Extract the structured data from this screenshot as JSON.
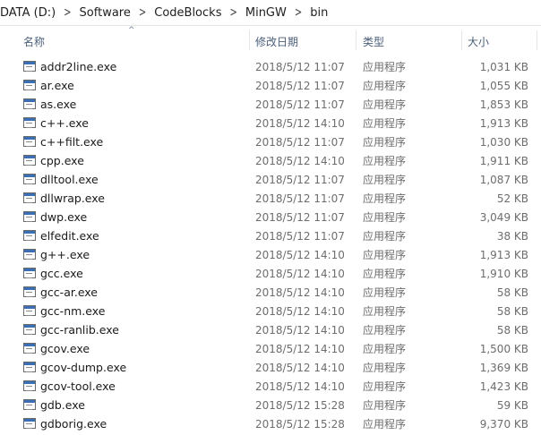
{
  "breadcrumb": [
    "DATA (D:)",
    "Software",
    "CodeBlocks",
    "MinGW",
    "bin"
  ],
  "columns": {
    "name": "名称",
    "date": "修改日期",
    "type": "类型",
    "size": "大小"
  },
  "files": [
    {
      "name": "addr2line.exe",
      "date": "2018/5/12 11:07",
      "type": "应用程序",
      "size": "1,031 KB"
    },
    {
      "name": "ar.exe",
      "date": "2018/5/12 11:07",
      "type": "应用程序",
      "size": "1,055 KB"
    },
    {
      "name": "as.exe",
      "date": "2018/5/12 11:07",
      "type": "应用程序",
      "size": "1,853 KB"
    },
    {
      "name": "c++.exe",
      "date": "2018/5/12 14:10",
      "type": "应用程序",
      "size": "1,913 KB"
    },
    {
      "name": "c++filt.exe",
      "date": "2018/5/12 11:07",
      "type": "应用程序",
      "size": "1,030 KB"
    },
    {
      "name": "cpp.exe",
      "date": "2018/5/12 14:10",
      "type": "应用程序",
      "size": "1,911 KB"
    },
    {
      "name": "dlltool.exe",
      "date": "2018/5/12 11:07",
      "type": "应用程序",
      "size": "1,087 KB"
    },
    {
      "name": "dllwrap.exe",
      "date": "2018/5/12 11:07",
      "type": "应用程序",
      "size": "52 KB"
    },
    {
      "name": "dwp.exe",
      "date": "2018/5/12 11:07",
      "type": "应用程序",
      "size": "3,049 KB"
    },
    {
      "name": "elfedit.exe",
      "date": "2018/5/12 11:07",
      "type": "应用程序",
      "size": "38 KB"
    },
    {
      "name": "g++.exe",
      "date": "2018/5/12 14:10",
      "type": "应用程序",
      "size": "1,913 KB"
    },
    {
      "name": "gcc.exe",
      "date": "2018/5/12 14:10",
      "type": "应用程序",
      "size": "1,910 KB"
    },
    {
      "name": "gcc-ar.exe",
      "date": "2018/5/12 14:10",
      "type": "应用程序",
      "size": "58 KB"
    },
    {
      "name": "gcc-nm.exe",
      "date": "2018/5/12 14:10",
      "type": "应用程序",
      "size": "58 KB"
    },
    {
      "name": "gcc-ranlib.exe",
      "date": "2018/5/12 14:10",
      "type": "应用程序",
      "size": "58 KB"
    },
    {
      "name": "gcov.exe",
      "date": "2018/5/12 14:10",
      "type": "应用程序",
      "size": "1,500 KB"
    },
    {
      "name": "gcov-dump.exe",
      "date": "2018/5/12 14:10",
      "type": "应用程序",
      "size": "1,369 KB"
    },
    {
      "name": "gcov-tool.exe",
      "date": "2018/5/12 14:10",
      "type": "应用程序",
      "size": "1,423 KB"
    },
    {
      "name": "gdb.exe",
      "date": "2018/5/12 15:28",
      "type": "应用程序",
      "size": "59 KB"
    },
    {
      "name": "gdborig.exe",
      "date": "2018/5/12 15:28",
      "type": "应用程序",
      "size": "9,370 KB"
    }
  ]
}
